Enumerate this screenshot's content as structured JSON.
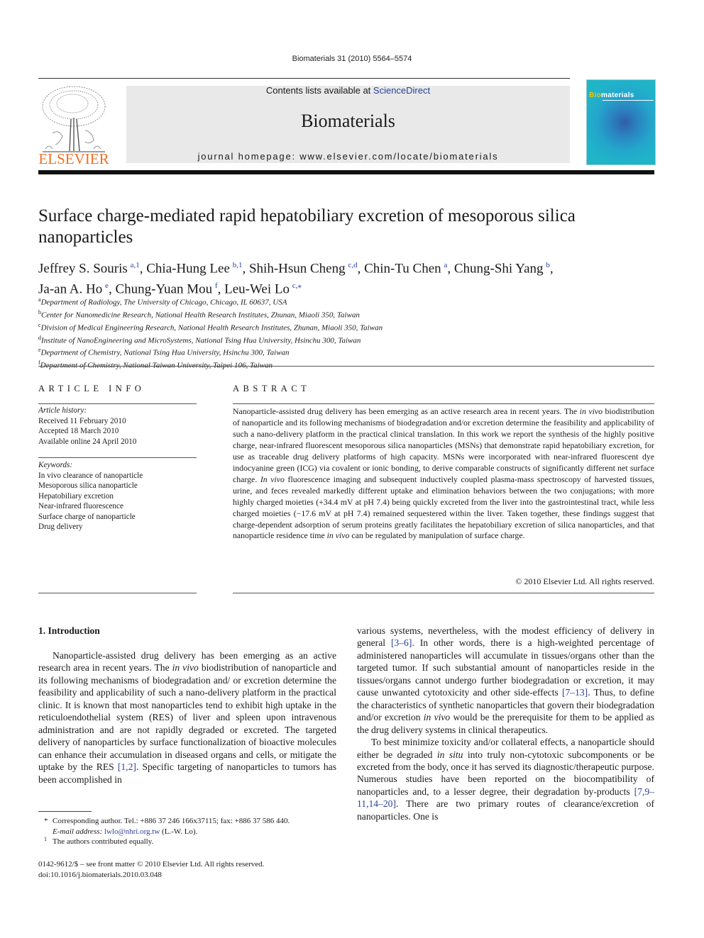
{
  "header": {
    "citation": "Biomaterials 31 (2010) 5564–5574",
    "contents_prefix": "Contents lists available at ",
    "contents_link": "ScienceDirect",
    "journal_name": "Biomaterials",
    "homepage": "journal homepage: www.elsevier.com/locate/biomaterials",
    "publisher_logo_text": "ELSEVIER",
    "cover_title_highlight": "Bio",
    "cover_title_rest": "materials",
    "colors": {
      "link": "#2a3f9c",
      "elsevier_orange": "#f26f21",
      "cover_teal": "#20b4c9"
    }
  },
  "article": {
    "title": "Surface charge-mediated rapid hepatobiliary excretion of mesoporous silica nanoparticles",
    "authors": [
      {
        "name": "Jeffrey S. Souris",
        "sup": "a,1"
      },
      {
        "name": "Chia-Hung Lee",
        "sup": "b,1"
      },
      {
        "name": "Shih-Hsun Cheng",
        "sup": "c,d"
      },
      {
        "name": "Chin-Tu Chen",
        "sup": "a"
      },
      {
        "name": "Chung-Shi Yang",
        "sup": "b"
      },
      {
        "name": "Ja-an A. Ho",
        "sup": "e"
      },
      {
        "name": "Chung-Yuan Mou",
        "sup": "f"
      },
      {
        "name": "Leu-Wei Lo",
        "sup": "c,⁎"
      }
    ],
    "affiliations": [
      {
        "key": "a",
        "text": "Department of Radiology, The University of Chicago, Chicago, IL 60637, USA"
      },
      {
        "key": "b",
        "text": "Center for Nanomedicine Research, National Health Research Institutes, Zhunan, Miaoli 350, Taiwan"
      },
      {
        "key": "c",
        "text": "Division of Medical Engineering Research, National Health Research Institutes, Zhunan, Miaoli 350, Taiwan"
      },
      {
        "key": "d",
        "text": "Institute of NanoEngineering and MicroSystems, National Tsing Hua University, Hsinchu 300, Taiwan"
      },
      {
        "key": "e",
        "text": "Department of Chemistry, National Tsing Hua University, Hsinchu 300, Taiwan"
      },
      {
        "key": "f",
        "text": "Department of Chemistry, National Taiwan University, Taipei 106, Taiwan"
      }
    ]
  },
  "article_info": {
    "heading": "ARTICLE INFO",
    "history_label": "Article history:",
    "received": "Received 11 February 2010",
    "accepted": "Accepted 18 March 2010",
    "online": "Available online 24 April 2010",
    "keywords_label": "Keywords:",
    "keywords": [
      "In vivo clearance of nanoparticle",
      "Mesoporous silica nanoparticle",
      "Hepatobiliary excretion",
      "Near-infrared fluorescence",
      "Surface charge of nanoparticle",
      "Drug delivery"
    ]
  },
  "abstract": {
    "heading": "ABSTRACT",
    "parts": [
      "Nanoparticle-assisted drug delivery has been emerging as an active research area in recent years. The ",
      "in vivo",
      " biodistribution of nanoparticle and its following mechanisms of biodegradation and/or excretion determine the feasibility and applicability of such a nano-delivery platform in the practical clinical translation. In this work we report the synthesis of the highly positive charge, near-infrared fluorescent mesoporous silica nanoparticles (MSNs) that demonstrate rapid hepatobiliary excretion, for use as traceable drug delivery platforms of high capacity. MSNs were incorporated with near-infrared fluorescent dye indocyanine green (ICG) via covalent or ionic bonding, to derive comparable constructs of significantly different net surface charge. ",
      "In vivo",
      " fluorescence imaging and subsequent inductively coupled plasma-mass spectroscopy of harvested tissues, urine, and feces revealed markedly different uptake and elimination behaviors between the two conjugations; with more highly charged moieties (+34.4 mV at pH 7.4) being quickly excreted from the liver into the gastrointestinal tract, while less charged moieties (−17.6 mV at pH 7.4) remained sequestered within the liver. Taken together, these findings suggest that charge-dependent adsorption of serum proteins greatly facilitates the hepatobiliary excretion of silica nanoparticles, and that nanoparticle residence time ",
      "in vivo",
      " can be regulated by manipulation of surface charge."
    ],
    "copyright": "© 2010 Elsevier Ltd. All rights reserved."
  },
  "introduction": {
    "heading": "1.  Introduction",
    "left_p1": [
      "Nanoparticle-assisted drug delivery has been emerging as an active research area in recent years. The ",
      "in vivo",
      " biodistribution of nanoparticle and its following mechanisms of biodegradation and/ or excretion determine the feasibility and applicability of such a nano-delivery platform in the practical clinic. It is known that most nanoparticles tend to exhibit high uptake in the reticuloendothelial system (RES) of liver and spleen upon intravenous administration and are not rapidly degraded or excreted. The targeted delivery of nanoparticles by surface functionalization of bioactive molecules can enhance their accumulation in diseased organs and cells, or mitigate the uptake by the RES ",
      "[1,2]",
      ". Specific targeting of nanoparticles to tumors has been accomplished in"
    ],
    "right_p1": [
      "various systems, nevertheless, with the modest efficiency of delivery in general ",
      "[3–6]",
      ". In other words, there is a high-weighted percentage of administered nanoparticles will accumulate in tissues/organs other than the targeted tumor. If such substantial amount of nanoparticles reside in the tissues/organs cannot undergo further biodegradation or excretion, it may cause unwanted cytotoxicity and other side-effects ",
      "[7–13]",
      ". Thus, to define the characteristics of synthetic nanoparticles that govern their biodegradation and/or excretion ",
      "in vivo",
      " would be the prerequisite for them to be applied as the drug delivery systems in clinical therapeutics."
    ],
    "right_p2": [
      "To best minimize toxicity and/or collateral effects, a nanoparticle should either be degraded ",
      "in situ",
      " into truly non-cytotoxic subcomponents or be excreted from the body, once it has served its diagnostic/therapeutic purpose. Numerous studies have been reported on the biocompatibility of nanoparticles and, to a lesser degree, their degradation by-products ",
      "[7,9–11,14–20]",
      ". There are two primary routes of clearance/excretion of nanoparticles. One is"
    ]
  },
  "footnotes": {
    "corresponding_mark": "*",
    "corresponding": "Corresponding author. Tel.: +886 37 246 166x37115; fax: +886 37 586 440.",
    "email_label": "E-mail address:",
    "email": "lwlo@nhri.org.tw",
    "email_suffix": " (L.-W. Lo).",
    "equal_mark": "1",
    "equal": "The authors contributed equally."
  },
  "front_matter": {
    "issn_line": "0142-9612/$ – see front matter © 2010 Elsevier Ltd. All rights reserved.",
    "doi": "doi:10.1016/j.biomaterials.2010.03.048"
  }
}
